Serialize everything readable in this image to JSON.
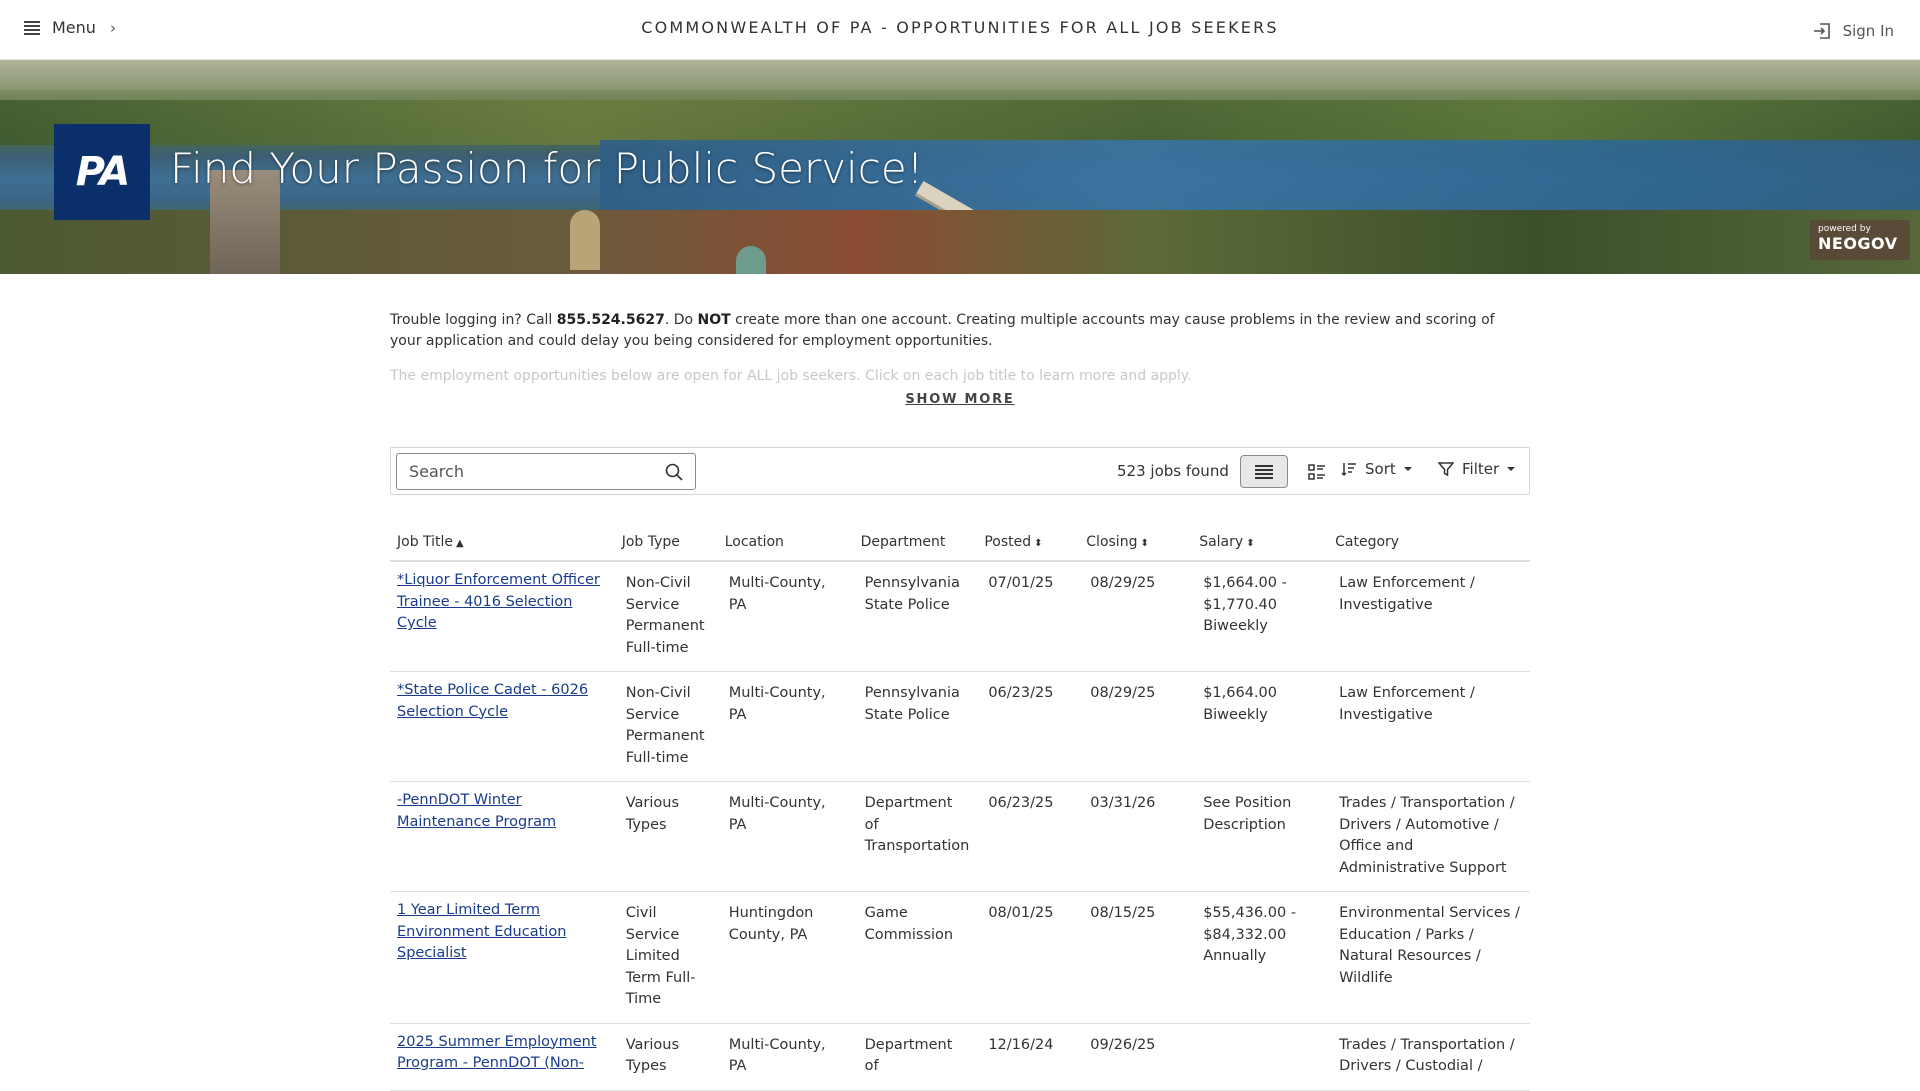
{
  "header": {
    "menu_label": "Menu",
    "site_title": "COMMONWEALTH OF PA - OPPORTUNITIES FOR ALL JOB SEEKERS",
    "signin_label": "Sign In"
  },
  "hero": {
    "logo_text": "PA",
    "title": "Find Your Passion for Public Service!",
    "powered_by": "powered by",
    "neogov": "NEOGOV"
  },
  "notice": {
    "part1": "Trouble logging in? Call ",
    "phone": "855.524.5627",
    "part2": ". Do ",
    "not": "NOT",
    "part3": " create more than one account.  Creating multiple accounts may cause problems in the review and scoring of your application and could delay you being considered for employment opportunities.",
    "faded": "The employment opportunities below are open for ALL job seekers. Click on each job title to learn more and apply.",
    "show_more": "SHOW MORE"
  },
  "toolbar": {
    "search_placeholder": "Search",
    "jobs_found": "523 jobs found",
    "sort_label": "Sort",
    "filter_label": "Filter"
  },
  "table": {
    "headers": {
      "title": "Job Title",
      "type": "Job Type",
      "location": "Location",
      "department": "Department",
      "posted": "Posted",
      "closing": "Closing",
      "salary": "Salary",
      "category": "Category"
    },
    "rows": [
      {
        "title": "*Liquor Enforcement Officer Trainee - 4016 Selection Cycle",
        "type": "Non-Civil Service Permanent Full-time",
        "location": "Multi-County, PA",
        "department": "Pennsylvania State Police",
        "posted": "07/01/25",
        "closing": "08/29/25",
        "salary": "$1,664.00 - $1,770.40 Biweekly",
        "category": "Law Enforcement / Investigative"
      },
      {
        "title": "*State Police Cadet - 6026 Selection Cycle",
        "type": "Non-Civil Service Permanent Full-time",
        "location": "Multi-County, PA",
        "department": "Pennsylvania State Police",
        "posted": "06/23/25",
        "closing": "08/29/25",
        "salary": "$1,664.00 Biweekly",
        "category": "Law Enforcement / Investigative"
      },
      {
        "title": "-PennDOT Winter Maintenance Program",
        "type": "Various Types",
        "location": "Multi-County, PA",
        "department": "Department of Transportation",
        "posted": "06/23/25",
        "closing": "03/31/26",
        "salary": "See Position Description",
        "category": "Trades / Transportation / Drivers / Automotive / Office and Administrative Support"
      },
      {
        "title": "1 Year Limited Term Environment Education Specialist",
        "type": "Civil Service Limited Term Full-Time",
        "location": "Huntingdon County, PA",
        "department": "Game Commission",
        "posted": "08/01/25",
        "closing": "08/15/25",
        "salary": "$55,436.00 - $84,332.00 Annually",
        "category": "Environmental Services / Education / Parks / Natural Resources / Wildlife"
      },
      {
        "title": "2025 Summer Employment Program - PennDOT (Non-",
        "type": "Various Types",
        "location": "Multi-County, PA",
        "department": "Department of",
        "posted": "12/16/24",
        "closing": "09/26/25",
        "salary": "",
        "category": "Trades / Transportation / Drivers / Custodial /"
      }
    ]
  }
}
